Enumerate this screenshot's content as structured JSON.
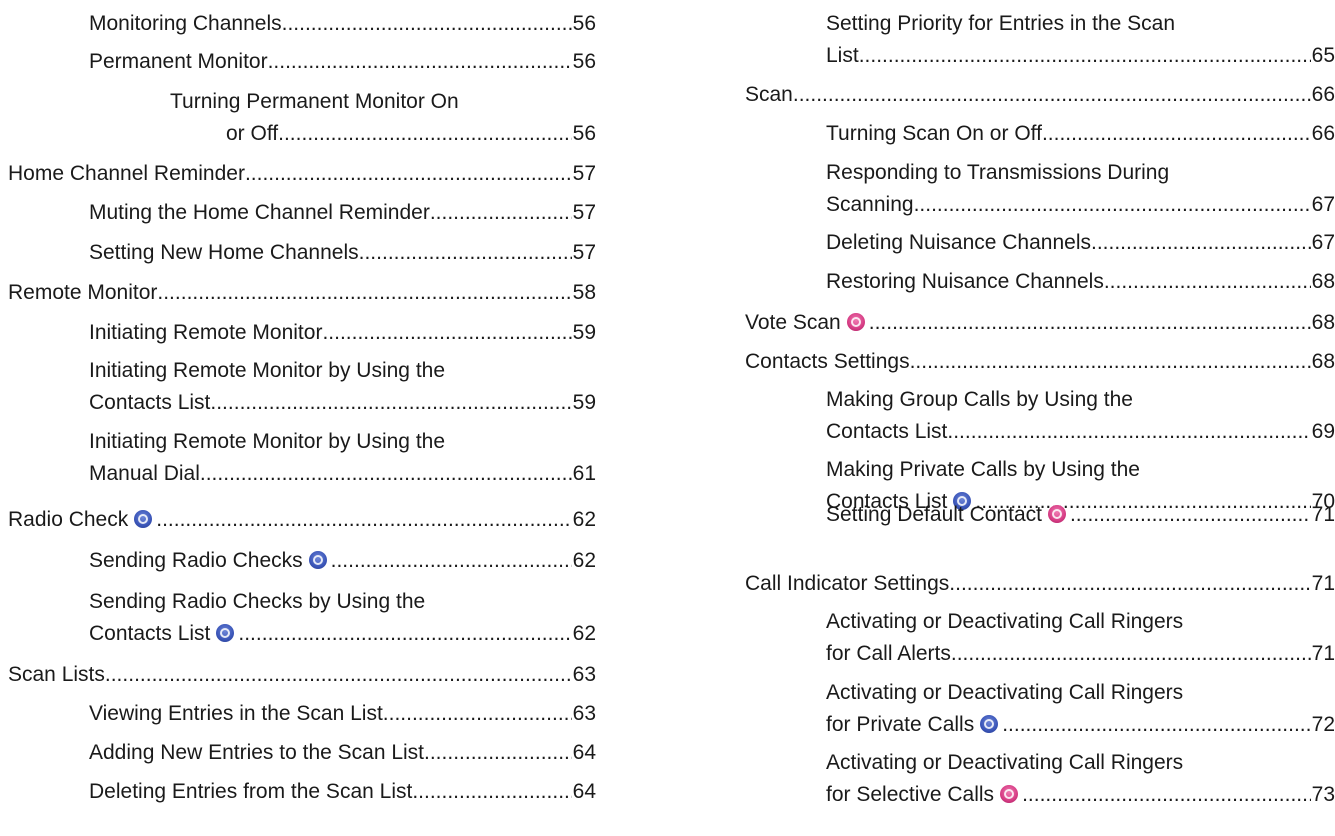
{
  "left": [
    {
      "text": "Monitoring Channels",
      "page": "56"
    },
    {
      "text": "Permanent Monitor",
      "page": "56"
    },
    {
      "lines": [
        "Turning Permanent Monitor On",
        "or Off"
      ],
      "page": "56"
    },
    {
      "text": "Home Channel Reminder",
      "page": "57"
    },
    {
      "text": "Muting the Home Channel Reminder",
      "page": "57"
    },
    {
      "text": "Setting New Home Channels",
      "page": "57"
    },
    {
      "text": "Remote Monitor",
      "page": "58"
    },
    {
      "text": "Initiating Remote Monitor",
      "page": "59"
    },
    {
      "lines": [
        "Initiating Remote Monitor by Using the",
        "Contacts List"
      ],
      "page": "59"
    },
    {
      "lines": [
        "Initiating Remote Monitor by Using the",
        "Manual Dial"
      ],
      "page": "61"
    },
    {
      "text": "Radio Check",
      "page": "62",
      "icon": "digital-mode-icon"
    },
    {
      "text": "Sending Radio Checks",
      "page": "62",
      "icon": "digital-mode-icon"
    },
    {
      "lines": [
        "Sending Radio Checks by Using the",
        "Contacts List"
      ],
      "page": "62",
      "icon": "digital-mode-icon"
    },
    {
      "text": "Scan Lists",
      "page": "63"
    },
    {
      "text": "Viewing Entries in the Scan List",
      "page": "63"
    },
    {
      "text": "Adding New Entries to the Scan List",
      "page": "64"
    },
    {
      "text": "Deleting Entries from the Scan List",
      "page": "64"
    }
  ],
  "right": [
    {
      "lines": [
        "Setting Priority for Entries in the Scan",
        "List"
      ],
      "page": "65"
    },
    {
      "text": "Scan",
      "page": "66"
    },
    {
      "text": "Turning Scan On or Off",
      "page": "66"
    },
    {
      "lines": [
        "Responding to Transmissions During",
        "Scanning"
      ],
      "page": "67"
    },
    {
      "text": "Deleting Nuisance Channels",
      "page": "67"
    },
    {
      "text": "Restoring Nuisance Channels",
      "page": "68"
    },
    {
      "text": "Vote Scan",
      "page": "68",
      "icon": "analog-mode-icon"
    },
    {
      "text": "Contacts Settings",
      "page": "68"
    },
    {
      "lines": [
        "Making Group Calls by Using the",
        "Contacts List"
      ],
      "page": "69"
    },
    {
      "lines": [
        "Making Private Calls by Using the",
        "Contacts List"
      ],
      "page": "70",
      "icon": "digital-mode-icon"
    },
    {
      "text": "Setting Default Contact",
      "page": "71",
      "icon": "analog-mode-icon"
    },
    {
      "text": "Call Indicator Settings",
      "page": "71"
    },
    {
      "lines": [
        "Activating or Deactivating Call Ringers",
        "for Call Alerts"
      ],
      "page": "71"
    },
    {
      "lines": [
        "Activating or Deactivating Call Ringers",
        "for Private Calls"
      ],
      "page": "72",
      "icon": "digital-mode-icon"
    },
    {
      "lines": [
        "Activating or Deactivating Call Ringers",
        "for Selective Calls"
      ],
      "page": "73",
      "icon": "analog-mode-icon"
    }
  ]
}
